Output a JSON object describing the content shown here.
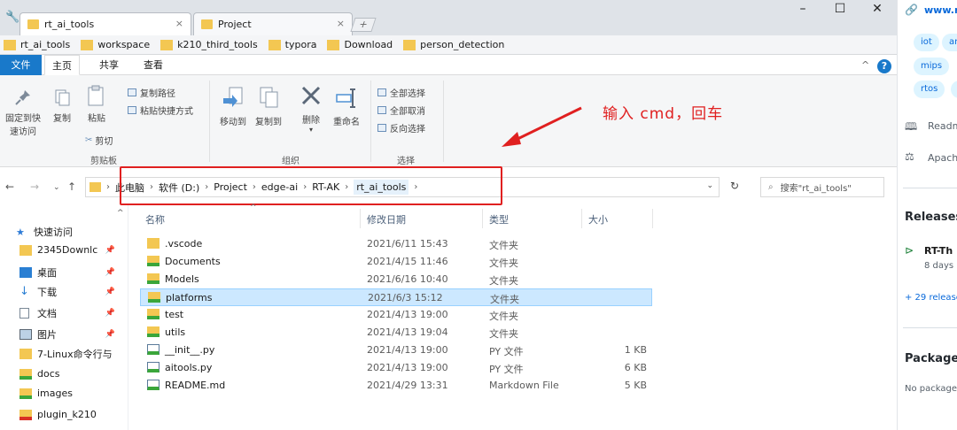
{
  "browser": {
    "tabs": [
      {
        "title": "rt_ai_tools"
      },
      {
        "title": "Project"
      }
    ],
    "close_glyph": "×",
    "bookmarks": [
      "rt_ai_tools",
      "workspace",
      "k210_third_tools",
      "typora",
      "Download",
      "person_detection"
    ],
    "window_controls": {
      "minimize": "–",
      "maximize": "☐",
      "close": "✕"
    }
  },
  "ribbon": {
    "tabs": [
      "文件",
      "主页",
      "共享",
      "查看"
    ],
    "pin_label_1": "固定到快",
    "pin_label_2": "速访问",
    "copy_label": "复制",
    "paste_label": "粘贴",
    "copy_path_label": "复制路径",
    "paste_shortcut_label": "粘贴快捷方式",
    "cut_label": "剪切",
    "clipboard_group": "剪贴板",
    "move_to_label": "移动到",
    "copy_to_label": "复制到",
    "delete_label": "删除",
    "rename_label": "重命名",
    "organize_group": "组织",
    "select_all_label": "全部选择",
    "select_none_label": "全部取消",
    "invert_label": "反向选择",
    "select_group": "选择",
    "collapse_glyph": "^",
    "help_glyph": "?"
  },
  "annotation": {
    "text": "输入 cmd，回车",
    "color": "#e02020"
  },
  "address": {
    "crumbs": [
      "此电脑",
      "软件 (D:)",
      "Project",
      "edge-ai",
      "RT-AK",
      "rt_ai_tools"
    ],
    "search_placeholder": "搜索\"rt_ai_tools\""
  },
  "nav": {
    "items": [
      {
        "label": "快速访问",
        "icon": "star-icon"
      },
      {
        "label": "2345Downlc",
        "icon": "folder-icon"
      },
      {
        "label": "桌面",
        "icon": "desktop-icon"
      },
      {
        "label": "下载",
        "icon": "download-icon"
      },
      {
        "label": "文档",
        "icon": "document-icon"
      },
      {
        "label": "图片",
        "icon": "picture-icon"
      },
      {
        "label": "7-Linux命令行与",
        "icon": "folder-icon"
      },
      {
        "label": "docs",
        "icon": "folder-synced-icon"
      },
      {
        "label": "images",
        "icon": "folder-synced-icon"
      },
      {
        "label": "plugin_k210",
        "icon": "folder-error-icon"
      }
    ]
  },
  "files": {
    "columns": [
      "名称",
      "修改日期",
      "类型",
      "大小"
    ],
    "rows": [
      {
        "name": ".vscode",
        "date": "2021/6/11 15:43",
        "type": "文件夹",
        "size": "",
        "icon": "folder-icon"
      },
      {
        "name": "Documents",
        "date": "2021/4/15 11:46",
        "type": "文件夹",
        "size": "",
        "icon": "folder-synced-icon"
      },
      {
        "name": "Models",
        "date": "2021/6/16 10:40",
        "type": "文件夹",
        "size": "",
        "icon": "folder-synced-icon"
      },
      {
        "name": "platforms",
        "date": "2021/6/3 15:12",
        "type": "文件夹",
        "size": "",
        "icon": "folder-synced-icon",
        "selected": true
      },
      {
        "name": "test",
        "date": "2021/4/13 19:00",
        "type": "文件夹",
        "size": "",
        "icon": "folder-synced-icon"
      },
      {
        "name": "utils",
        "date": "2021/4/13 19:04",
        "type": "文件夹",
        "size": "",
        "icon": "folder-synced-icon"
      },
      {
        "name": "__init__.py",
        "date": "2021/4/13 19:00",
        "type": "PY 文件",
        "size": "1 KB",
        "icon": "python-file-icon"
      },
      {
        "name": "aitools.py",
        "date": "2021/4/13 19:00",
        "type": "PY 文件",
        "size": "6 KB",
        "icon": "python-file-icon"
      },
      {
        "name": "README.md",
        "date": "2021/4/29 13:31",
        "type": "Markdown File",
        "size": "5 KB",
        "icon": "markdown-file-icon"
      }
    ]
  },
  "github": {
    "url": "www.r",
    "tags": [
      "iot",
      "ar",
      "mips",
      "rtos",
      "u"
    ],
    "readme": "Readm",
    "license": "Apach",
    "releases_heading": "Releases",
    "release_name": "RT-Th",
    "release_age": "8 days a",
    "more_releases": "+ 29 release",
    "packages_heading": "Packages",
    "packages_text": "No package"
  }
}
